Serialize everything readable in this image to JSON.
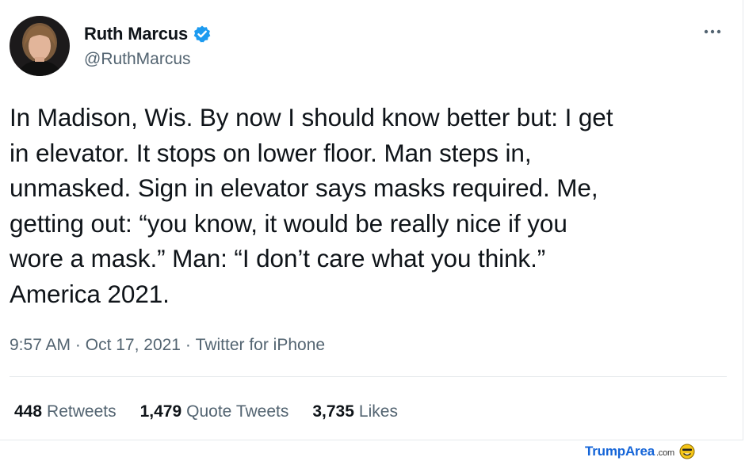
{
  "tweet": {
    "author": {
      "display_name": "Ruth Marcus",
      "handle": "@RuthMarcus",
      "verified": true
    },
    "text": "In Madison, Wis. By now I should know better but: I get\nin elevator. It stops on lower floor. Man steps in,\nunmasked. Sign in elevator says masks required. Me,\ngetting out: “you know, it would be really nice if you\nwore a mask.” Man: “I don’t care what you think.”\nAmerica 2021.",
    "time": "9:57 AM",
    "date": "Oct 17, 2021",
    "source": "Twitter for iPhone",
    "separator": " · "
  },
  "stats": {
    "retweets": {
      "count": "448",
      "label": "Retweets"
    },
    "quote_tweets": {
      "count": "1,479",
      "label": "Quote Tweets"
    },
    "likes": {
      "count": "3,735",
      "label": "Likes"
    }
  },
  "watermark": {
    "brand": "TrumpArea",
    "tld": ".com"
  },
  "colors": {
    "verified": "#1d9bf0",
    "secondary_text": "#536471",
    "primary_text": "#0f1419",
    "watermark": "#1565d8"
  },
  "icons": {
    "verified": "verified-badge-icon",
    "more": "more-options-icon",
    "watermark_face": "smiley-face-icon"
  }
}
